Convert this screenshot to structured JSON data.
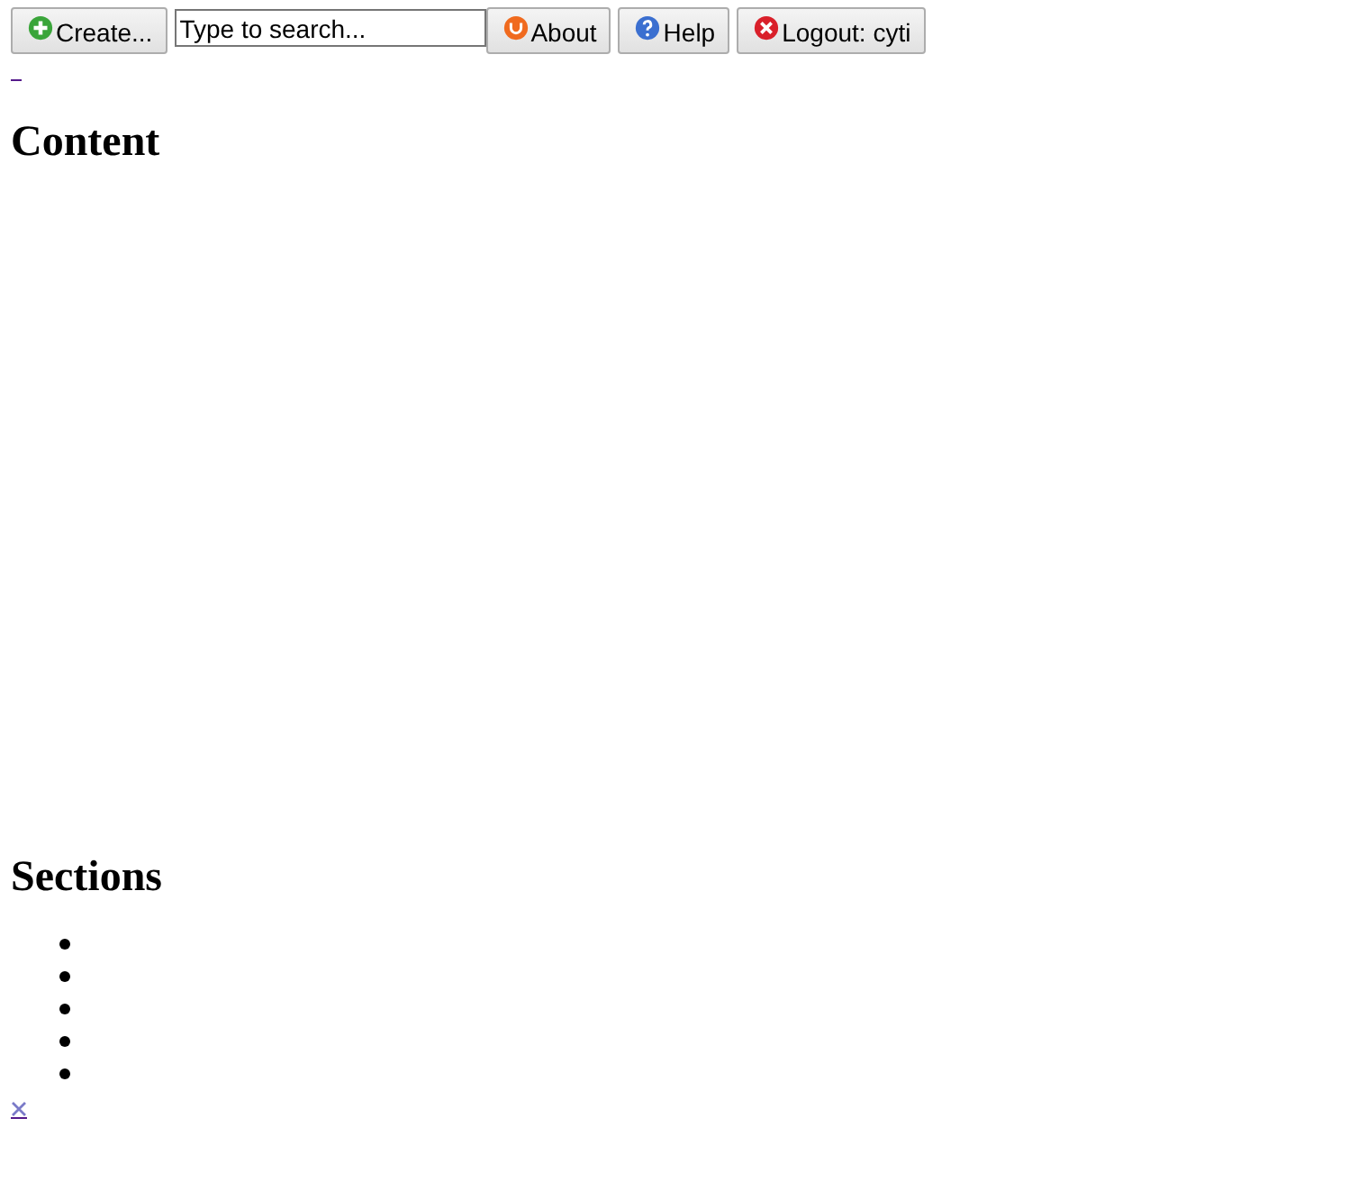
{
  "toolbar": {
    "items": [
      {
        "kind": "button",
        "label": "Create..."
      },
      {
        "kind": "search",
        "value": "Type to search..."
      },
      {
        "kind": "button",
        "label": "About"
      },
      {
        "kind": "button",
        "label": "Help"
      },
      {
        "kind": "button",
        "label": "Logout: cyti"
      }
    ]
  },
  "content": {
    "heading": "Content"
  },
  "sections": {
    "heading": "Sections",
    "items": [
      {
        "kind": "bullet"
      },
      {
        "kind": "bullet"
      },
      {
        "kind": "bullet"
      },
      {
        "kind": "bullet"
      },
      {
        "kind": "bullet"
      }
    ]
  }
}
